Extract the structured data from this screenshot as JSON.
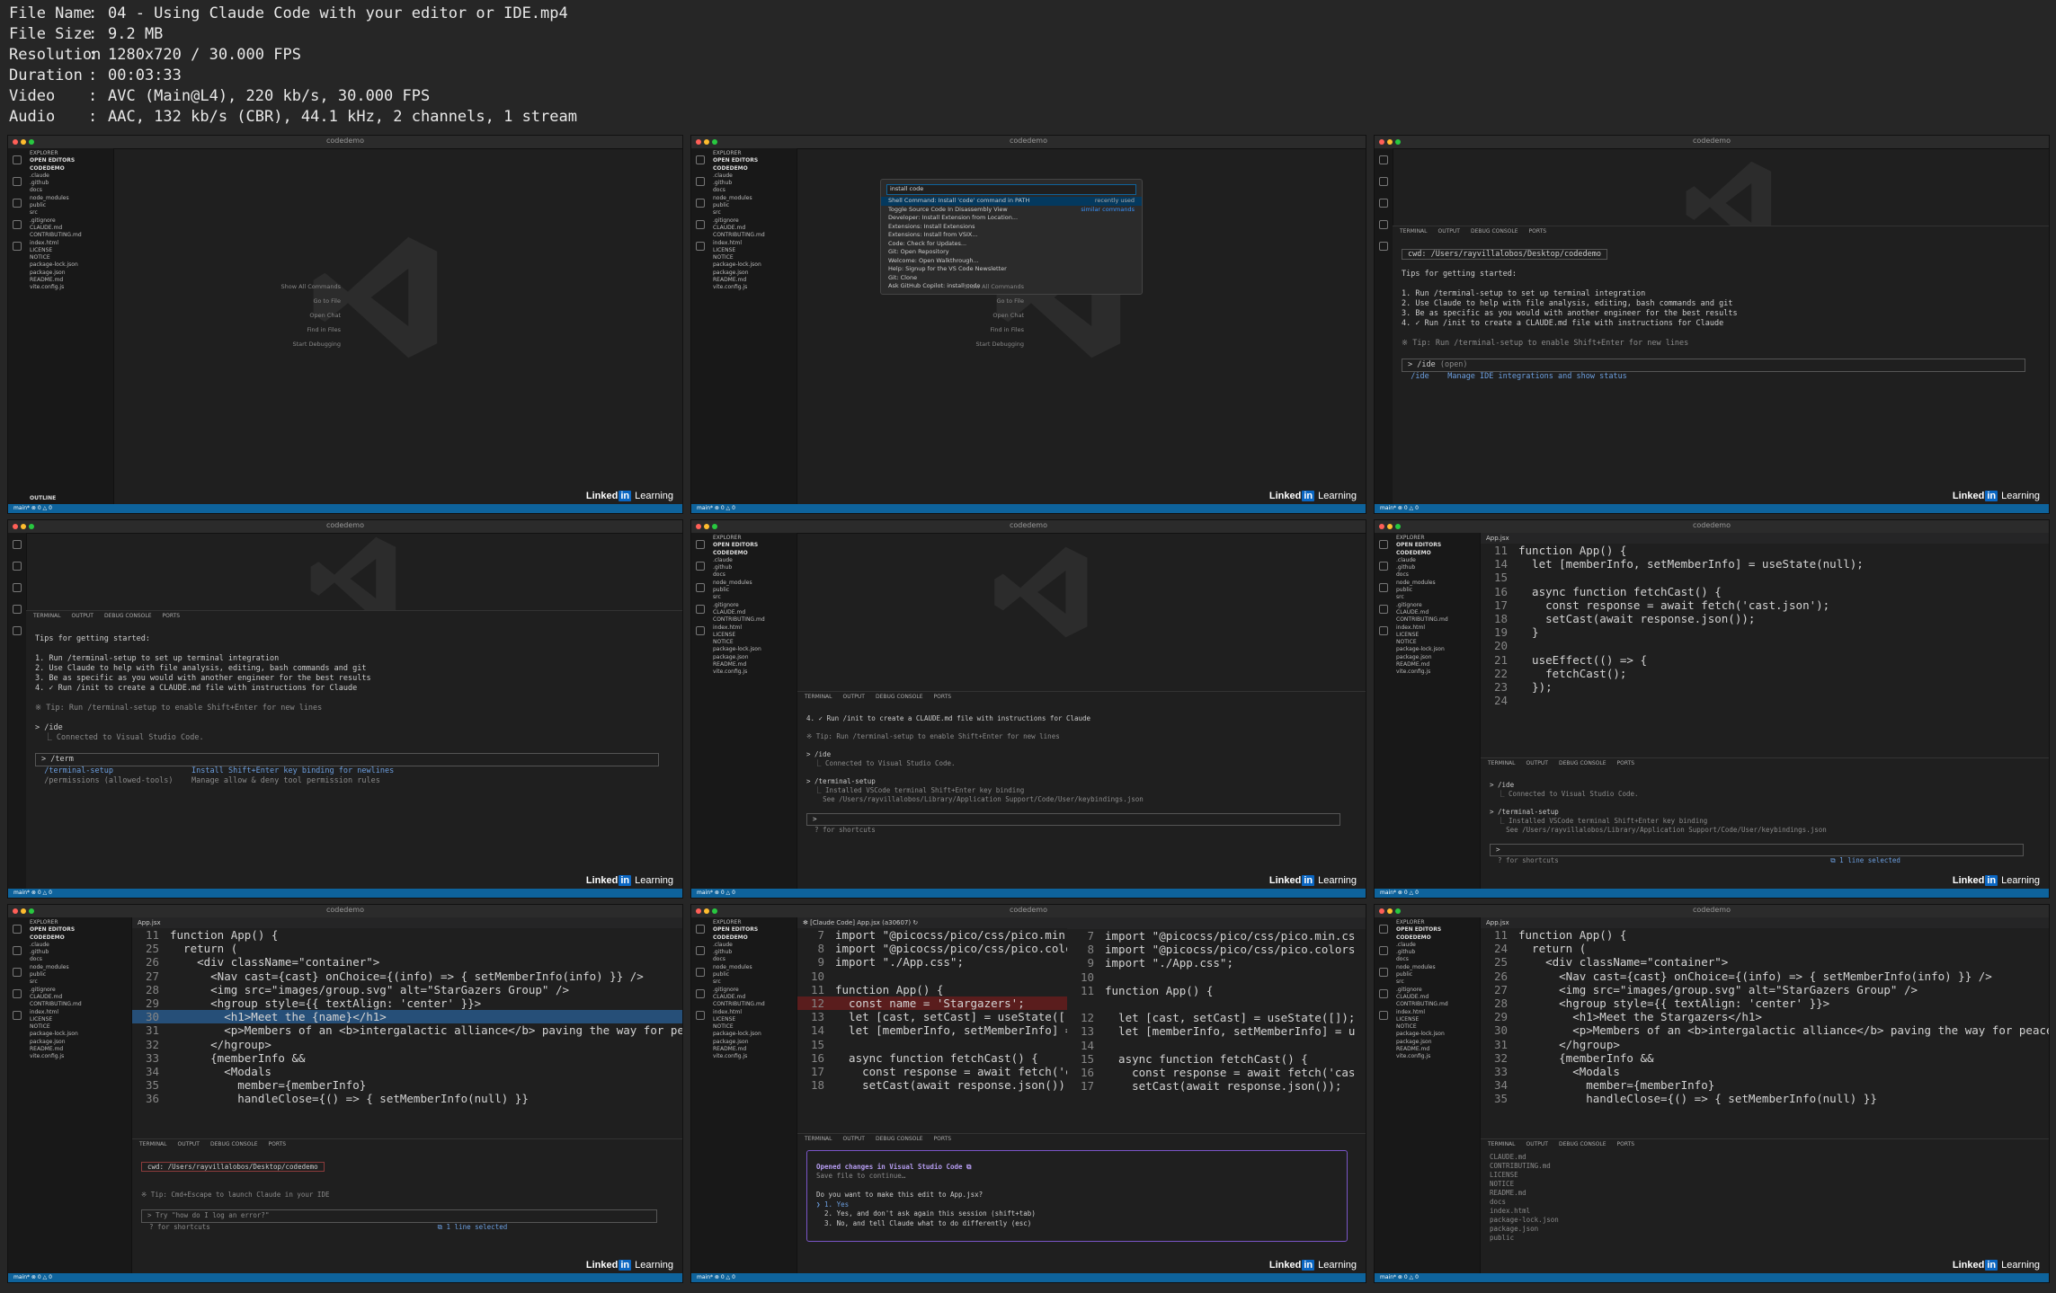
{
  "header": {
    "rows": [
      {
        "key": "File Name",
        "value": "04 - Using Claude Code with your editor or IDE.mp4"
      },
      {
        "key": "File Size",
        "value": "9.2 MB"
      },
      {
        "key": "Resolution",
        "value": "1280x720 / 30.000 FPS"
      },
      {
        "key": "Duration",
        "value": "00:03:33"
      },
      {
        "key": "Video",
        "value": "AVC (Main@L4), 220 kb/s, 30.000 FPS"
      },
      {
        "key": "Audio",
        "value": "AAC, 132 kb/s (CBR), 44.1 kHz, 2 channels, 1 stream"
      }
    ]
  },
  "common": {
    "window_title": "codedemo",
    "brand_a": "Linked",
    "brand_b": "in",
    "brand_c": " Learning",
    "status_left": "main* ⊗ 0 △ 0",
    "explorer_title": "EXPLORER",
    "open_editors": "OPEN EDITORS",
    "project": "CODEDEMO",
    "outline": "OUTLINE",
    "term_tabs": [
      "TERMINAL",
      "OUTPUT",
      "DEBUG CONSOLE",
      "PORTS"
    ]
  },
  "explorer_files": [
    ".claude",
    ".github",
    "docs",
    "node_modules",
    "public",
    "src",
    ".gitignore",
    "CLAUDE.md",
    "CONTRIBUTING.md",
    "index.html",
    "LICENSE",
    "NOTICE",
    "package-lock.json",
    "package.json",
    "README.md",
    "vite.config.js"
  ],
  "welcome": [
    "Show All Commands",
    "Go to File",
    "Open Chat",
    "Find in Files",
    "Start Debugging"
  ],
  "palette": {
    "input": "install code",
    "items": [
      "Shell Command: Install 'code' command in PATH",
      "Toggle Source Code In Disassembly View",
      "Developer: Install Extension from Location...",
      "Extensions: Install Extensions",
      "Extensions: Install from VSIX...",
      "Code: Check for Updates...",
      "Git: Open Repository",
      "Welcome: Open Walkthrough...",
      "Help: Signup for the VS Code Newsletter",
      "Git: Clone",
      "Ask GitHub Copilot: install code"
    ],
    "badge": "recently used",
    "badge2": "similar commands"
  },
  "panel3": {
    "cwd": "cwd: /Users/rayvillalobos/Desktop/codedemo",
    "tips_title": "Tips for getting started:",
    "tips": [
      "1. Run /terminal-setup to set up terminal integration",
      "2. Use Claude to help with file analysis, editing, bash commands and git",
      "3. Be as specific as you would with another engineer for the best results",
      "4. ✓ Run /init to create a CLAUDE.md file with instructions for Claude"
    ],
    "tip": "※ Tip: Run /terminal-setup to enable Shift+Enter for new lines",
    "input": "> /ide",
    "input_hint": " (open)",
    "cmd": "/ide",
    "cmd_desc": "Manage IDE integrations and show status"
  },
  "panel4": {
    "ide_cmd": "> /ide",
    "connected": "⎿ Connected to Visual Studio Code.",
    "input": "> /term",
    "s1": "/terminal-setup",
    "s1d": "Install Shift+Enter key binding for newlines",
    "s2": "/permissions (allowed-tools)",
    "s2d": "Manage allow & deny tool permission rules"
  },
  "panel5": {
    "l1": "4. ✓ Run /init to create a CLAUDE.md file with instructions for Claude",
    "l2": "※ Tip: Run /terminal-setup to enable Shift+Enter for new lines",
    "l3": "> /ide",
    "l4": "⎿ Connected to Visual Studio Code.",
    "l5": "> /terminal-setup",
    "l6": "⎿ Installed VSCode terminal Shift+Enter key binding",
    "l7": "See /Users/rayvillalobos/Library/Application Support/Code/User/keybindings.json",
    "prompt": ">",
    "shortcuts": "? for shortcuts"
  },
  "panel6": {
    "tab": "App.jsx",
    "code": [
      {
        "n": "11",
        "t": "function App() {"
      },
      {
        "n": "14",
        "t": "  let [memberInfo, setMemberInfo] = useState(null);"
      },
      {
        "n": "15",
        "t": ""
      },
      {
        "n": "16",
        "t": "  async function fetchCast() {"
      },
      {
        "n": "17",
        "t": "    const response = await fetch('cast.json');"
      },
      {
        "n": "18",
        "t": "    setCast(await response.json());"
      },
      {
        "n": "19",
        "t": "  }"
      },
      {
        "n": "20",
        "t": ""
      },
      {
        "n": "21",
        "t": "  useEffect(() => {"
      },
      {
        "n": "22",
        "t": "    fetchCast();"
      },
      {
        "n": "23",
        "t": "  });"
      },
      {
        "n": "24",
        "t": ""
      }
    ],
    "selected": "⧉ 1 line selected"
  },
  "panel7": {
    "code": [
      {
        "n": "11",
        "t": "function App() {"
      },
      {
        "n": "25",
        "t": "  return ("
      },
      {
        "n": "26",
        "t": "    <div className=\"container\">"
      },
      {
        "n": "27",
        "t": "      <Nav cast={cast} onChoice={(info) => { setMemberInfo(info) }} />"
      },
      {
        "n": "28",
        "t": "      <img src=\"images/group.svg\" alt=\"StarGazers Group\" />"
      },
      {
        "n": "29",
        "t": "      <hgroup style={{ textAlign: 'center' }}>"
      },
      {
        "n": "30",
        "t": "        <h1>Meet the {name}</h1>"
      },
      {
        "n": "31",
        "t": "        <p>Members of an <b>intergalactic alliance</b> paving the way for peace and"
      },
      {
        "n": "32",
        "t": "      </hgroup>"
      },
      {
        "n": "33",
        "t": "      {memberInfo &&"
      },
      {
        "n": "34",
        "t": "        <Modals"
      },
      {
        "n": "35",
        "t": "          member={memberInfo}"
      },
      {
        "n": "36",
        "t": "          handleClose={() => { setMemberInfo(null) }}"
      }
    ],
    "cwd": "cwd: /Users/rayvillalobos/Desktop/codedemo",
    "tip": "※ Tip: Cmd+Escape to launch Claude in your IDE",
    "prompt": "> Try \"how do I log an error?\"",
    "shortcuts": "? for shortcuts",
    "selected": "⧉ 1 line selected"
  },
  "panel8": {
    "tab": "✻ [Claude Code] App.jsx (a30607) ↻",
    "left": [
      {
        "n": "7",
        "t": "import \"@picocss/pico/css/pico.min."
      },
      {
        "n": "8",
        "t": "import \"@picocss/pico/css/pico.colc"
      },
      {
        "n": "9",
        "t": "import \"./App.css\";"
      },
      {
        "n": "10",
        "t": ""
      },
      {
        "n": "11",
        "t": "function App() {"
      },
      {
        "n": "12",
        "t": "  const name = 'Stargazers';"
      },
      {
        "n": "13",
        "t": "  let [cast, setCast] = useState([]"
      },
      {
        "n": "14",
        "t": "  let [memberInfo, setMemberInfo] ="
      },
      {
        "n": "15",
        "t": ""
      },
      {
        "n": "16",
        "t": "  async function fetchCast() {"
      },
      {
        "n": "17",
        "t": "    const response = await fetch('c"
      },
      {
        "n": "18",
        "t": "    setCast(await response.json());"
      }
    ],
    "right": [
      {
        "n": "7",
        "t": "import \"@picocss/pico/css/pico.min.cs"
      },
      {
        "n": "8",
        "t": "import \"@picocss/pico/css/pico.colors"
      },
      {
        "n": "9",
        "t": "import \"./App.css\";"
      },
      {
        "n": "10",
        "t": ""
      },
      {
        "n": "11",
        "t": "function App() {"
      },
      {
        "n": "",
        "t": ""
      },
      {
        "n": "12",
        "t": "  let [cast, setCast] = useState([]);"
      },
      {
        "n": "13",
        "t": "  let [memberInfo, setMemberInfo] = u"
      },
      {
        "n": "14",
        "t": ""
      },
      {
        "n": "15",
        "t": "  async function fetchCast() {"
      },
      {
        "n": "16",
        "t": "    const response = await fetch('cas"
      },
      {
        "n": "17",
        "t": "    setCast(await response.json());"
      }
    ],
    "d1": "Opened changes in Visual Studio Code ⧉",
    "d2": "Save file to continue…",
    "d3": "Do you want to make this edit to App.jsx?",
    "o1": "❯ 1. Yes",
    "o2": "  2. Yes, and don't ask again this session (shift+tab)",
    "o3": "  3. No, and tell Claude what to do differently (esc)"
  },
  "panel9": {
    "code": [
      {
        "n": "11",
        "t": "function App() {"
      },
      {
        "n": "24",
        "t": "  return ("
      },
      {
        "n": "25",
        "t": "    <div className=\"container\">"
      },
      {
        "n": "26",
        "t": "      <Nav cast={cast} onChoice={(info) => { setMemberInfo(info) }} />"
      },
      {
        "n": "27",
        "t": "      <img src=\"images/group.svg\" alt=\"StarGazers Group\" />"
      },
      {
        "n": "28",
        "t": "      <hgroup style={{ textAlign: 'center' }}>"
      },
      {
        "n": "29",
        "t": "        <h1>Meet the Stargazers</h1>"
      },
      {
        "n": "30",
        "t": "        <p>Members of an <b>intergalactic alliance</b> paving the way for peace and"
      },
      {
        "n": "31",
        "t": "      </hgroup>"
      },
      {
        "n": "32",
        "t": "      {memberInfo &&"
      },
      {
        "n": "33",
        "t": "        <Modals"
      },
      {
        "n": "34",
        "t": "          member={memberInfo}"
      },
      {
        "n": "35",
        "t": "          handleClose={() => { setMemberInfo(null) }}"
      }
    ],
    "files": [
      "CLAUDE.md",
      "CONTRIBUTING.md",
      "LICENSE",
      "NOTICE",
      "README.md",
      "docs",
      "index.html",
      "package-lock.json",
      "package.json",
      "public"
    ]
  }
}
